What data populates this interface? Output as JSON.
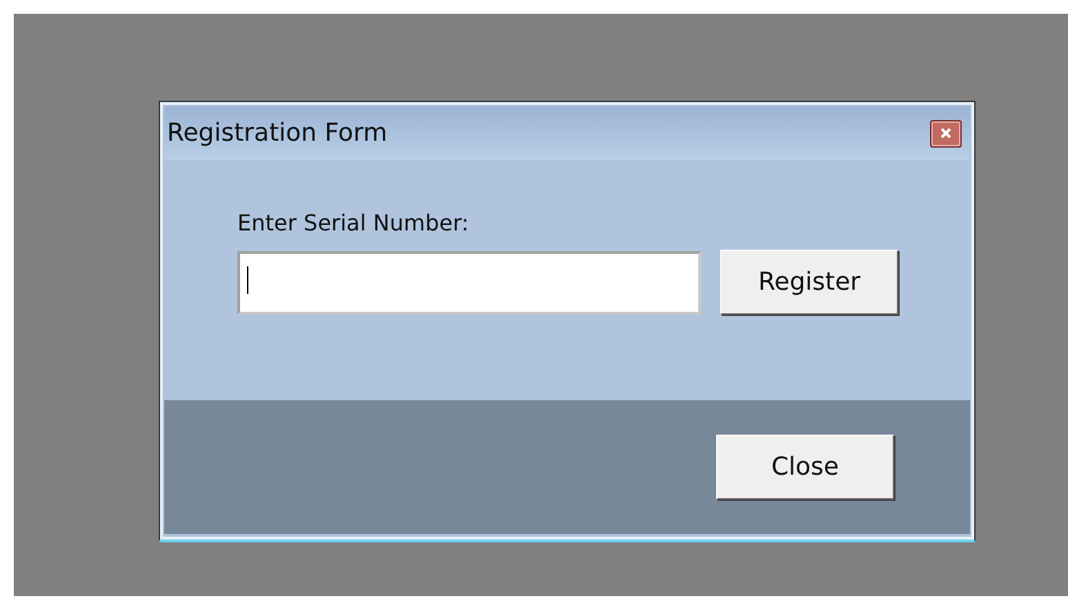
{
  "window": {
    "title": "Registration Form"
  },
  "serial": {
    "label": "Enter Serial Number:"
  },
  "buttons": [
    {
      "kind": "register",
      "label": "Register"
    },
    {
      "kind": "close",
      "label": "Close"
    }
  ]
}
